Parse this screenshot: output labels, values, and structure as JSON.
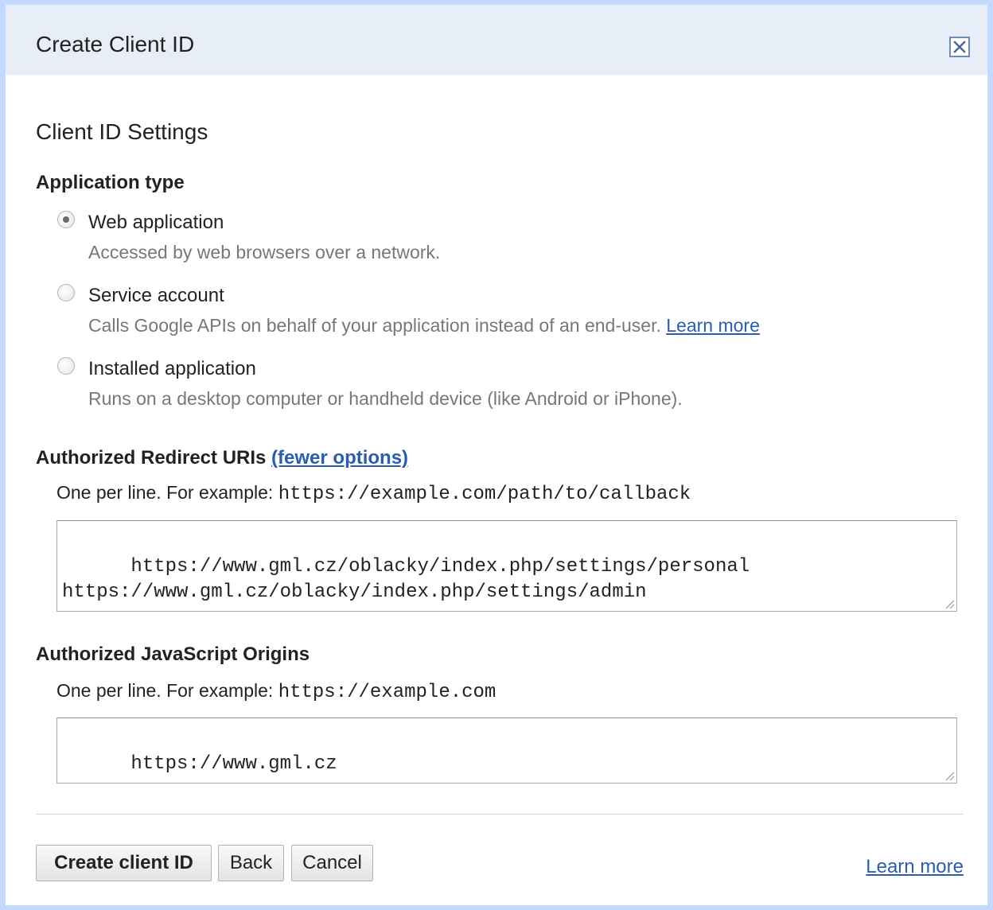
{
  "dialog": {
    "title": "Create Client ID"
  },
  "settings": {
    "title": "Client ID Settings",
    "application_type_label": "Application type",
    "options": [
      {
        "label": "Web application",
        "description": "Accessed by web browsers over a network.",
        "checked": true
      },
      {
        "label": "Service account",
        "description": "Calls Google APIs on behalf of your application instead of an end-user.",
        "link": "Learn more",
        "checked": false
      },
      {
        "label": "Installed application",
        "description": "Runs on a desktop computer or handheld device (like Android or iPhone).",
        "checked": false
      }
    ]
  },
  "redirect": {
    "label": "Authorized Redirect URIs",
    "toggle_link": "(fewer options)",
    "hint_text": "One per line. For example:",
    "hint_example": "https://example.com/path/to/callback",
    "value": "https://www.gml.cz/oblacky/index.php/settings/personal\nhttps://www.gml.cz/oblacky/index.php/settings/admin"
  },
  "origins": {
    "label": "Authorized JavaScript Origins",
    "hint_text": "One per line. For example:",
    "hint_example": "https://example.com",
    "value": "https://www.gml.cz"
  },
  "footer": {
    "create_label": "Create client ID",
    "back_label": "Back",
    "cancel_label": "Cancel",
    "learn_more": "Learn more"
  },
  "colors": {
    "frame": "#c3d9ff",
    "titlebar": "#e8eef7",
    "link": "#2a5db0"
  }
}
